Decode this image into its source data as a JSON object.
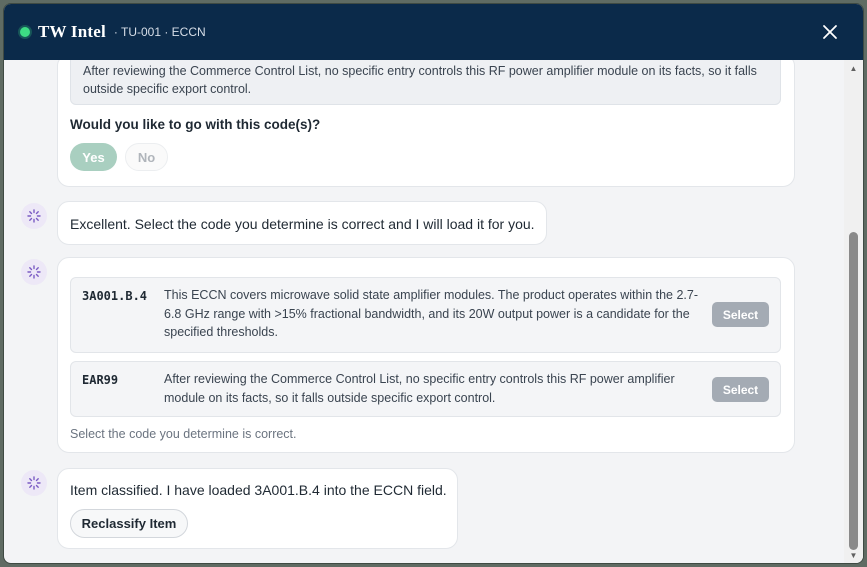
{
  "header": {
    "title": "TW Intel",
    "subtitle": "· TU-001 · ECCN",
    "close_icon": "close-icon",
    "status_color": "#3ddc84"
  },
  "messages": {
    "confirm": {
      "quote": "After reviewing the Commerce Control List, no specific entry controls this RF power amplifier module on its facts, so it falls outside specific export control.",
      "question": "Would you like to go with this code(s)?",
      "yes_label": "Yes",
      "no_label": "No"
    },
    "excellent": {
      "text": "Excellent. Select the code you determine is correct and I will load it for you."
    },
    "options": {
      "items": [
        {
          "code": "3A001.B.4",
          "description": "This ECCN covers microwave solid state amplifier modules. The product operates within the 2.7-6.8 GHz range with >15% fractional bandwidth, and its 20W output power is a candidate for the specified thresholds.",
          "select_label": "Select"
        },
        {
          "code": "EAR99",
          "description": "After reviewing the Commerce Control List, no specific entry controls this RF power amplifier module on its facts, so it falls outside specific export control.",
          "select_label": "Select"
        }
      ],
      "hint": "Select the code you determine is correct."
    },
    "classified": {
      "text": "Item classified. I have loaded 3A001.B.4 into the ECCN field.",
      "reclassify_label": "Reclassify Item"
    }
  },
  "colors": {
    "header_bg": "#0b2a4a",
    "yes_disabled": "#a9cfc0",
    "select_disabled": "#a4abb4"
  }
}
